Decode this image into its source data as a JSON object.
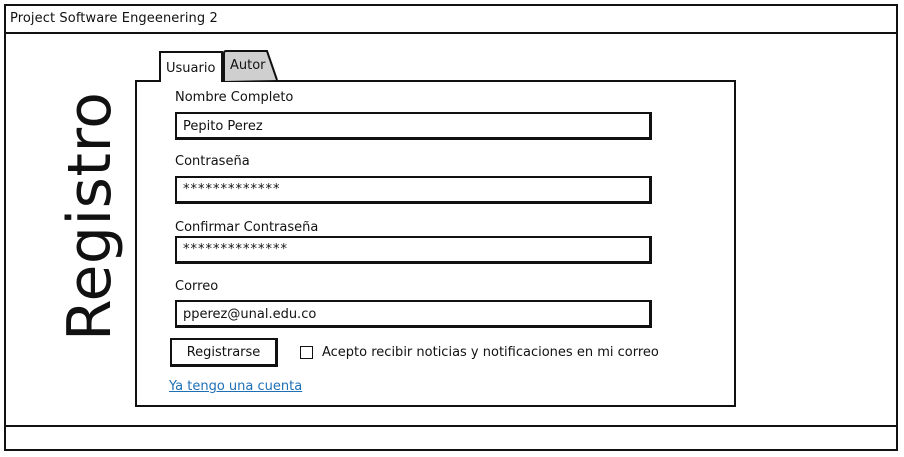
{
  "window": {
    "title": "Project Software Engeenering 2"
  },
  "page": {
    "heading": "Registro"
  },
  "tabs": [
    {
      "label": "Usuario",
      "selected": true
    },
    {
      "label": "Autor",
      "selected": false
    }
  ],
  "form": {
    "name": {
      "label": "Nombre Completo",
      "value": "Pepito Perez"
    },
    "password": {
      "label": "Contraseña",
      "value": "*************"
    },
    "confirm_password": {
      "label": "Confirmar Contraseña",
      "value": "**************"
    },
    "email": {
      "label": "Correo",
      "value": "pperez@unal.edu.co"
    },
    "submit_label": "Registrarse",
    "notifications_checkbox": {
      "label": "Acepto recibir noticias y notificaciones en mi correo",
      "checked": false
    },
    "login_link": "Ya tengo una cuenta"
  },
  "colors": {
    "border": "#111111",
    "link": "#1e6fb5",
    "inactive_tab": "#cfcfcf"
  }
}
